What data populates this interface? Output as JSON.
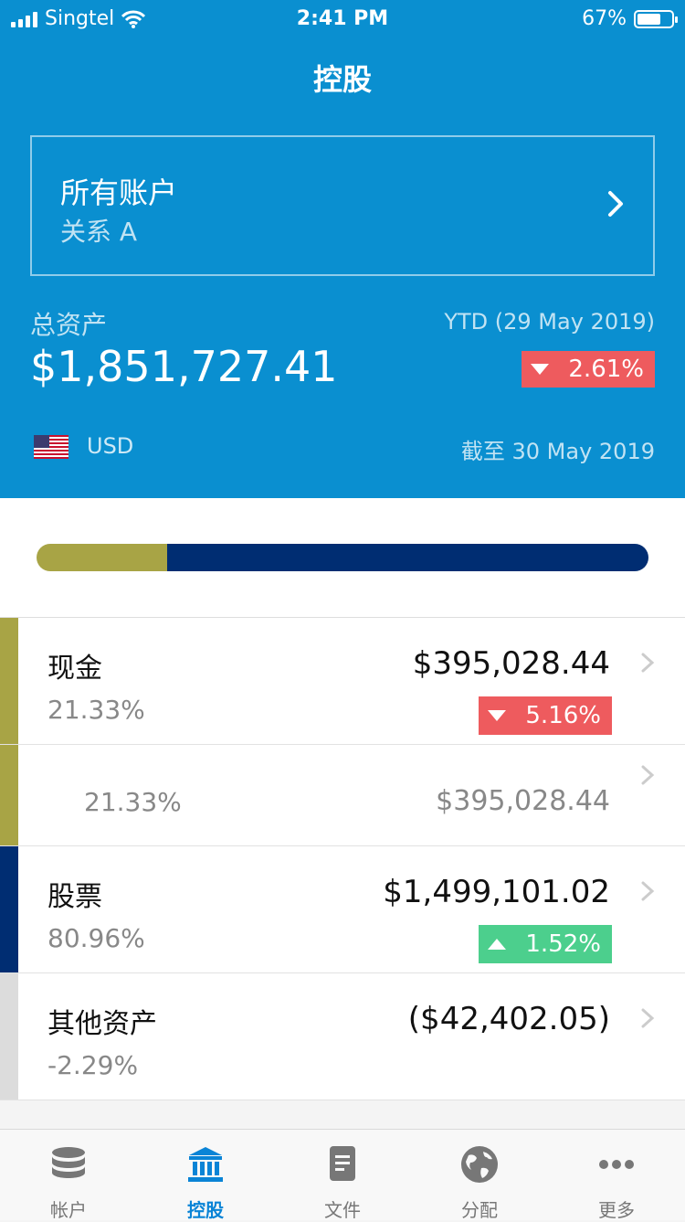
{
  "status_bar": {
    "carrier": "Singtel",
    "time": "2:41 PM",
    "battery": "67%"
  },
  "nav": {
    "title": "控股"
  },
  "account": {
    "name": "所有账户",
    "relation": "关系 A"
  },
  "summary": {
    "total_label": "总资产",
    "total_value": "$1,851,727.41",
    "ytd_label": "YTD (29 May 2019)",
    "ytd_change": "2.61%",
    "ytd_direction": "down",
    "currency": "USD",
    "as_of": "截至 30 May 2019"
  },
  "allocation_bar": [
    {
      "name": "现金",
      "share": 0.2133,
      "color": "#a8a445"
    },
    {
      "name": "股票",
      "share": 0.7867,
      "color": "#002d72"
    }
  ],
  "holdings": {
    "cash": {
      "title": "现金",
      "percent": "21.33%",
      "amount": "$395,028.44",
      "change": "5.16%",
      "direction": "down",
      "color": "#a8a445"
    },
    "cash_sub": {
      "percent": "21.33%",
      "amount": "$395,028.44",
      "color": "#a8a445"
    },
    "equity": {
      "title": "股票",
      "percent": "80.96%",
      "amount": "$1,499,101.02",
      "change": "1.52%",
      "direction": "up",
      "color": "#002d72"
    },
    "other": {
      "title": "其他资产",
      "percent": "-2.29%",
      "amount": "($42,402.05)",
      "color": "#dcdcdc"
    }
  },
  "tabs": [
    {
      "label": "帐户",
      "icon": "database-icon"
    },
    {
      "label": "控股",
      "icon": "bank-icon"
    },
    {
      "label": "文件",
      "icon": "document-icon"
    },
    {
      "label": "分配",
      "icon": "globe-icon"
    },
    {
      "label": "更多",
      "icon": "more-icon"
    }
  ],
  "colors": {
    "header": "#0a8fd0",
    "negative": "#ee5b5e",
    "positive": "#4ccf8d",
    "tab_active": "#0a84d6"
  }
}
